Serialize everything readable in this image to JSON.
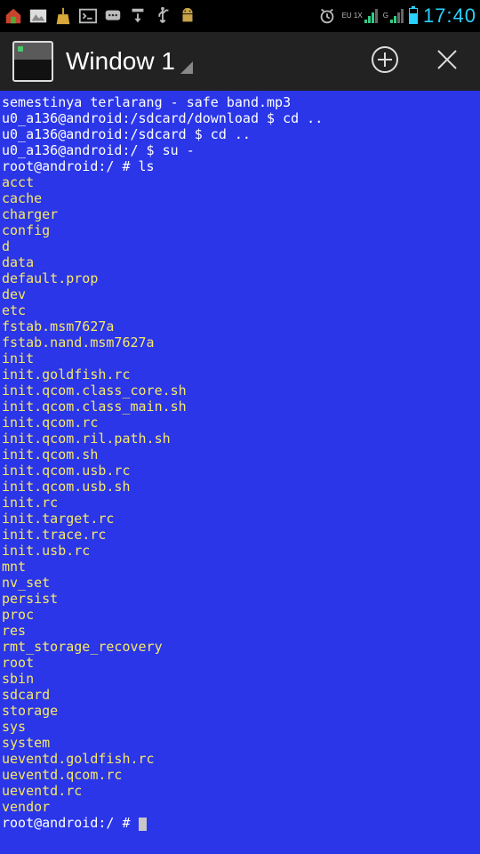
{
  "status_bar": {
    "clock": "17:40",
    "net_a_label": "EU\n1X",
    "net_b_label": "G"
  },
  "app_bar": {
    "title": "Window 1"
  },
  "terminal": {
    "lines": [
      "semestinya terlarang - safe band.mp3",
      "u0_a136@android:/sdcard/download $ cd ..",
      "u0_a136@android:/sdcard $ cd ..",
      "u0_a136@android:/ $ su -",
      "root@android:/ # ls",
      "acct",
      "cache",
      "charger",
      "config",
      "d",
      "data",
      "default.prop",
      "dev",
      "etc",
      "fstab.msm7627a",
      "fstab.nand.msm7627a",
      "init",
      "init.goldfish.rc",
      "init.qcom.class_core.sh",
      "init.qcom.class_main.sh",
      "init.qcom.rc",
      "init.qcom.ril.path.sh",
      "init.qcom.sh",
      "init.qcom.usb.rc",
      "init.qcom.usb.sh",
      "init.rc",
      "init.target.rc",
      "init.trace.rc",
      "init.usb.rc",
      "mnt",
      "nv_set",
      "persist",
      "proc",
      "res",
      "rmt_storage_recovery",
      "root",
      "sbin",
      "sdcard",
      "storage",
      "sys",
      "system",
      "ueventd.goldfish.rc",
      "ueventd.qcom.rc",
      "ueventd.rc",
      "vendor"
    ],
    "prompt": "root@android:/ # "
  }
}
